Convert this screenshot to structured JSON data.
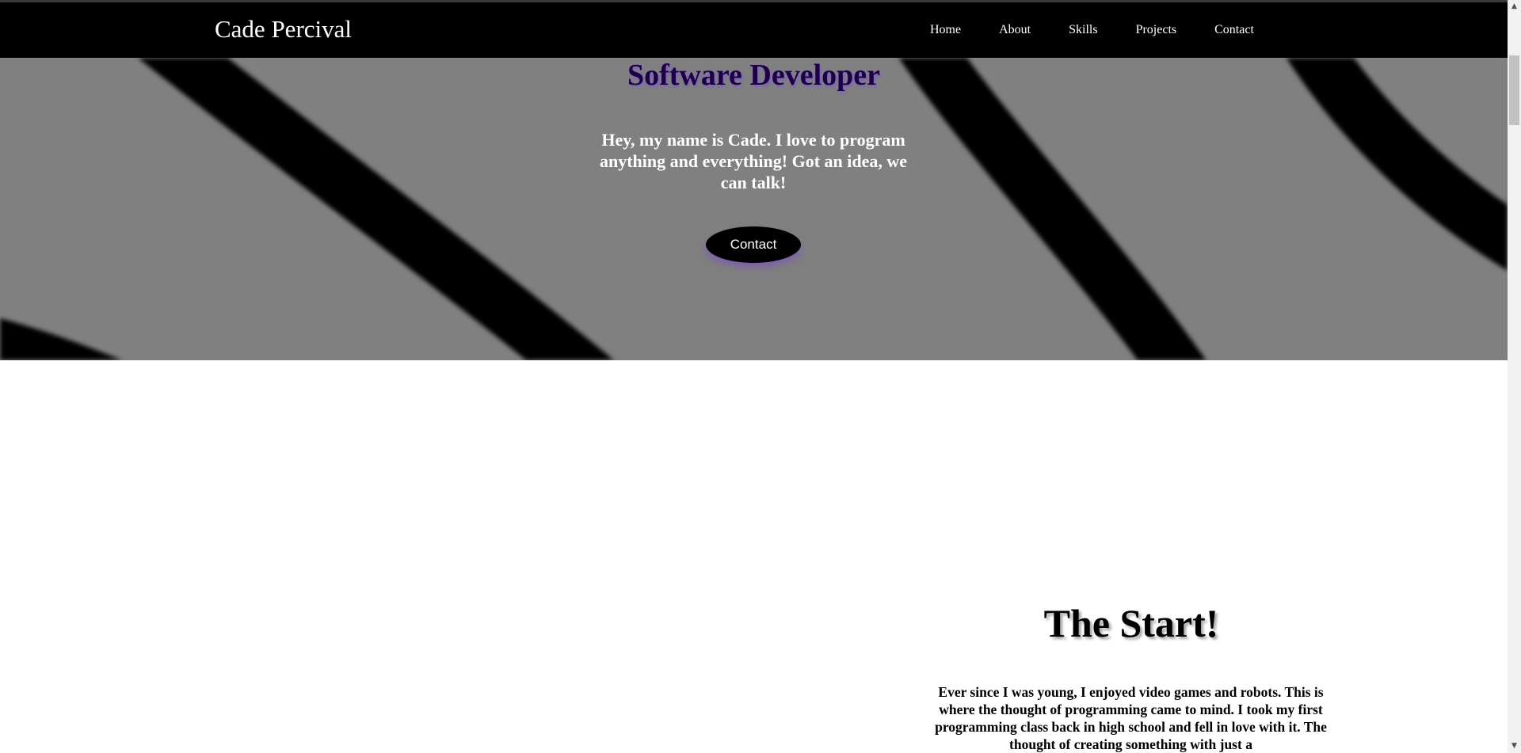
{
  "navbar": {
    "brand": "Cade Percival",
    "links": [
      "Home",
      "About",
      "Skills",
      "Projects",
      "Contact"
    ]
  },
  "hero": {
    "title": "Software Developer",
    "text": "Hey, my name is Cade. I love to program anything and everything! Got an idea, we can talk!",
    "button_label": "Contact"
  },
  "section": {
    "title": "The Start!",
    "text": "Ever since I was young, I enjoyed video games and robots. This is where the thought of programming came to mind. I took my first programming class back in high school and fell in love with it. The thought of creating something with just a"
  },
  "colors": {
    "navbar_bg": "#000000",
    "hero_bg": "#808080",
    "hero_title": "#1e0046",
    "accent_glow": "#8c5adc"
  },
  "icons": {
    "scroll_up": "chevron-up-icon",
    "scroll_down": "chevron-down-icon"
  }
}
